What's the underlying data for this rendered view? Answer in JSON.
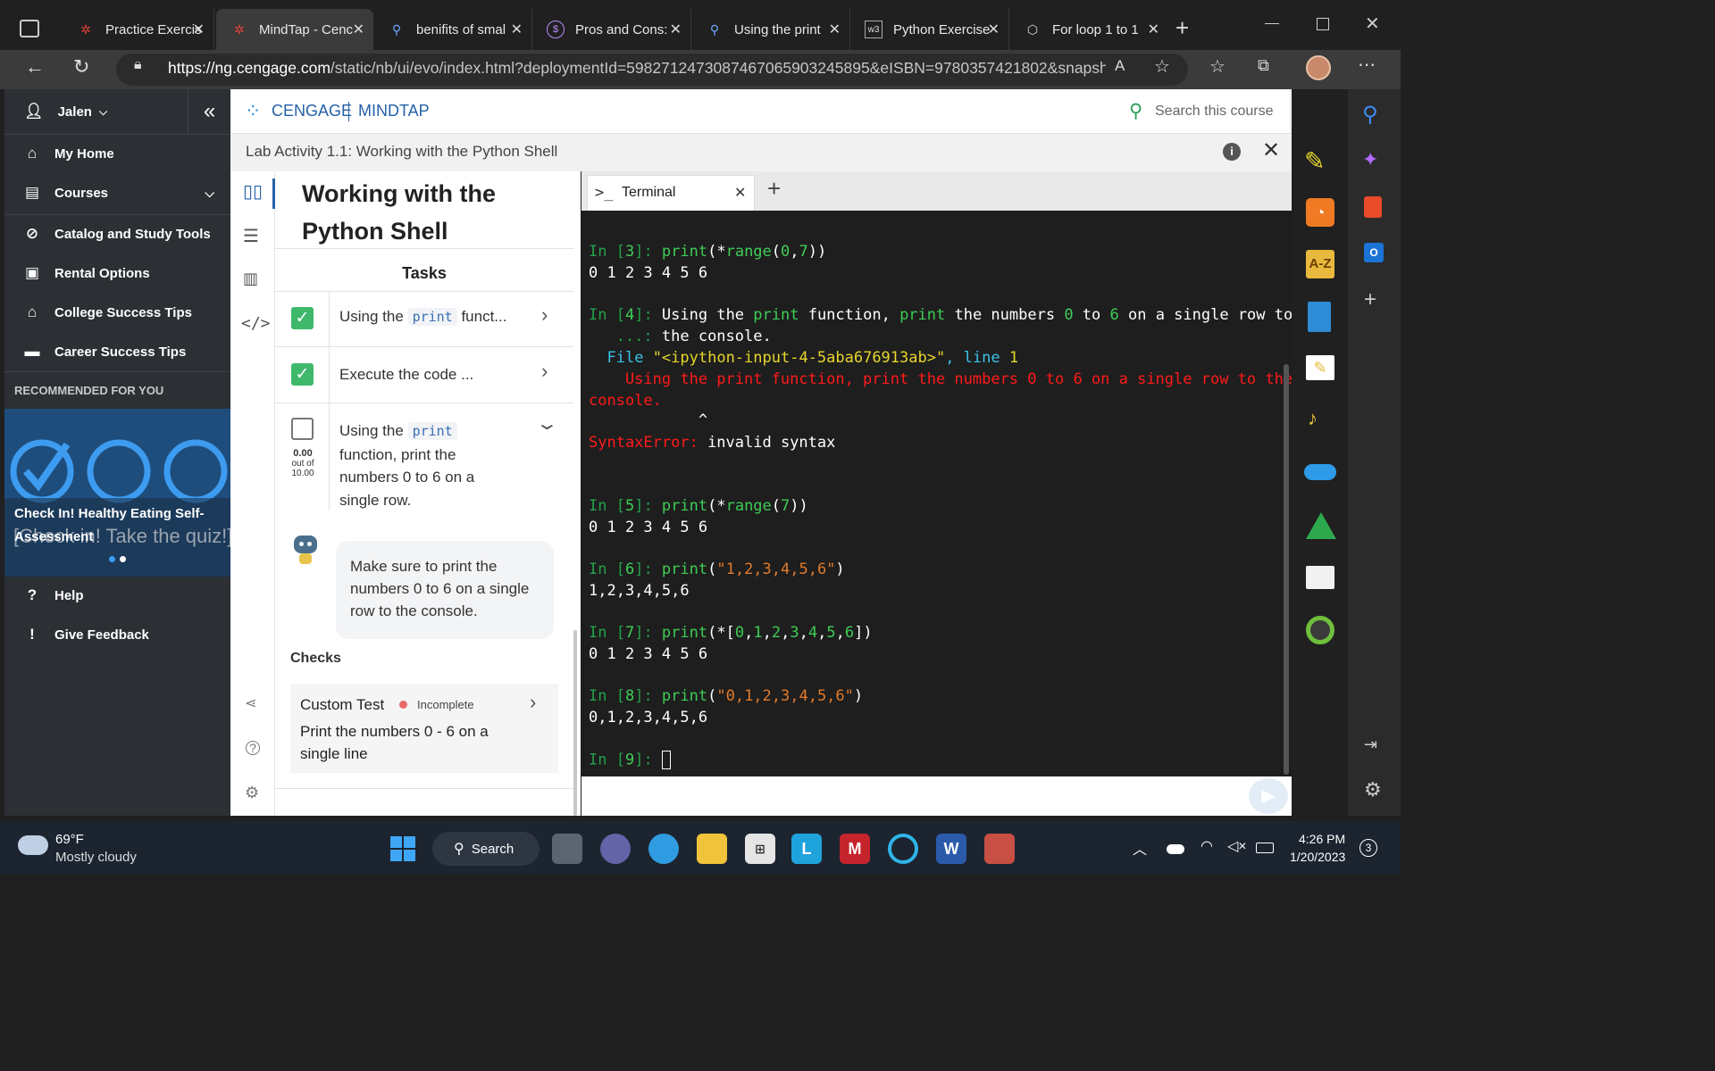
{
  "browser": {
    "tabs": [
      {
        "title": "Practice Exercis",
        "icon": "cengage-icon"
      },
      {
        "title": "MindTap - Cenc",
        "icon": "mindtap-icon",
        "active": true
      },
      {
        "title": "benifits of smal",
        "icon": "search-icon"
      },
      {
        "title": "Pros and Cons:",
        "icon": "pros-cons-icon"
      },
      {
        "title": "Using the print",
        "icon": "search-icon"
      },
      {
        "title": "Python Exercise",
        "icon": "w3schools-icon"
      },
      {
        "title": "For loop 1 to 1",
        "icon": "cube-icon"
      }
    ],
    "url_host": "https://ng.cengage.com",
    "url_path": "/static/nb/ui/evo/index.html?deploymentId=5982712473087467065903245895&eISBN=9780357421802&snapsh..."
  },
  "nav": {
    "user": "Jalen",
    "items": [
      {
        "label": "My Home",
        "icon": "home-icon"
      },
      {
        "label": "Courses",
        "icon": "courses-icon"
      },
      {
        "label": "Catalog and Study Tools",
        "icon": "compass-icon"
      },
      {
        "label": "Rental Options",
        "icon": "book-icon"
      },
      {
        "label": "College Success Tips",
        "icon": "graduation-cap-icon"
      },
      {
        "label": "Career Success Tips",
        "icon": "briefcase-icon"
      }
    ],
    "recommended_heading": "RECOMMENDED FOR YOU",
    "recommended_title": "Check In! Healthy Eating Self-Assessment",
    "recommended_bg_text": "[Check in! Take the quiz!]",
    "help": "Help",
    "feedback": "Give Feedback"
  },
  "header": {
    "brand": "CENGAGE",
    "product": "MINDTAP",
    "search_placeholder": "Search this course",
    "activity_title": "Lab Activity 1.1: Working with the Python Shell"
  },
  "reader": {
    "title_line1": "Working with the",
    "title_line2": "Python Shell",
    "tasks_heading": "Tasks",
    "task1_pre": "Using the",
    "task1_code": "print",
    "task1_post": "funct...",
    "task2": "Execute the code ...",
    "task3_pre": "Using the",
    "task3_code": "print",
    "task3_line2": "function, print the",
    "task3_line3": "numbers 0 to 6 on a",
    "task3_line4": "single row.",
    "score_value": "0.00",
    "score_out": "out of",
    "score_total": "10.00",
    "hint": "Make sure to print the numbers 0 to 6 on a single row to the console.",
    "checks_heading": "Checks",
    "check_title": "Custom Test",
    "check_status": "Incomplete",
    "check_desc": "Print the numbers 0 - 6 on a single line"
  },
  "terminal": {
    "tab_label": "Terminal",
    "prompt_char": ">_",
    "plus": "+"
  },
  "weather": {
    "temp": "69°F",
    "desc": "Mostly cloudy"
  },
  "taskbar": {
    "search": "Search",
    "time": "4:26 PM",
    "date": "1/20/2023",
    "notifications": "3"
  },
  "colors": {
    "accent_green": "#3fb86b",
    "nav_bg": "#2c2f33",
    "terminal_bg": "#1e1e1e",
    "error_red": "#ff1a1a"
  }
}
